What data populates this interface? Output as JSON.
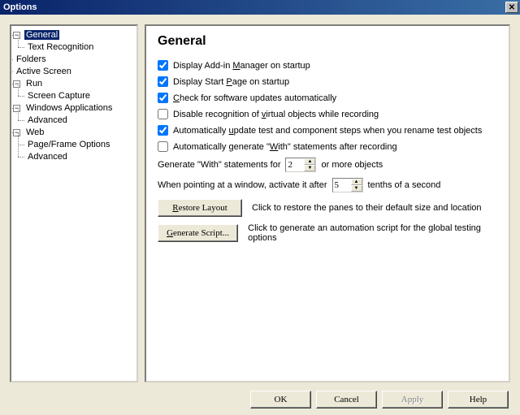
{
  "window": {
    "title": "Options"
  },
  "tree": {
    "general": "General",
    "general_children": {
      "text_recognition": "Text Recognition"
    },
    "folders": "Folders",
    "active_screen": "Active Screen",
    "run": "Run",
    "run_children": {
      "screen_capture": "Screen Capture"
    },
    "win_apps": "Windows Applications",
    "win_apps_children": {
      "advanced": "Advanced"
    },
    "web": "Web",
    "web_children": {
      "page_frame": "Page/Frame Options",
      "advanced": "Advanced"
    }
  },
  "content": {
    "heading": "General",
    "checks": {
      "addin": {
        "checked": true,
        "pre": "Display Add-in ",
        "u": "M",
        "post": "anager on startup"
      },
      "start": {
        "checked": true,
        "pre": "Display Start ",
        "u": "P",
        "post": "age on startup"
      },
      "updates": {
        "checked": true,
        "pre": "",
        "u": "C",
        "post": "heck for software updates automatically"
      },
      "virtual": {
        "checked": false,
        "pre": "Disable recognition of ",
        "u": "v",
        "post": "irtual objects while recording"
      },
      "autoupd": {
        "checked": true,
        "pre": "Automatically ",
        "u": "u",
        "post": "pdate test and component steps when you rename test objects"
      },
      "withgen": {
        "checked": false,
        "pre": "Automatically generate \"",
        "u": "W",
        "post": "ith\" statements after recording"
      }
    },
    "with_row": {
      "pre": "Generate \"With\" statements for",
      "value": "2",
      "post": "or more objects"
    },
    "activate_row": {
      "pre": "When pointing at a window, activate it after",
      "value": "5",
      "post": "tenths of a second"
    },
    "restore": {
      "pre": "",
      "u": "R",
      "post": "estore Layout",
      "desc": "Click to restore the panes to their default size and location"
    },
    "script": {
      "pre": "",
      "u": "G",
      "post": "enerate Script...",
      "desc": "Click to generate an automation script for the global testing options"
    }
  },
  "buttons": {
    "ok": "OK",
    "cancel": "Cancel",
    "apply": "Apply",
    "help": "Help"
  }
}
